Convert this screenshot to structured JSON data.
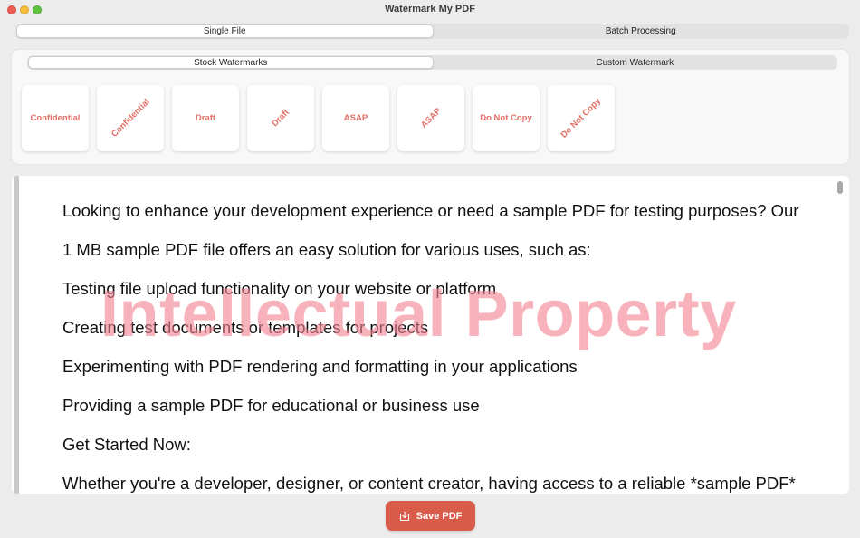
{
  "window": {
    "title": "Watermark My PDF"
  },
  "mode_tabs": [
    "Single File",
    "Batch Processing"
  ],
  "watermark_tabs": [
    "Stock Watermarks",
    "Custom Watermark"
  ],
  "stock_watermarks": [
    {
      "label": "Confidential",
      "orientation": "horizontal"
    },
    {
      "label": "Confidential",
      "orientation": "diagonal"
    },
    {
      "label": "Draft",
      "orientation": "horizontal"
    },
    {
      "label": "Draft",
      "orientation": "diagonal"
    },
    {
      "label": "ASAP",
      "orientation": "horizontal"
    },
    {
      "label": "ASAP",
      "orientation": "diagonal"
    },
    {
      "label": "Do Not Copy",
      "orientation": "horizontal"
    },
    {
      "label": "Do Not Copy",
      "orientation": "diagonal"
    }
  ],
  "document": {
    "lines": [
      "Looking to enhance your development experience or need a sample PDF for testing purposes? Our",
      "1 MB sample PDF file offers an easy solution for various uses, such as:",
      "Testing file upload functionality on your website or platform",
      "Creating test documents or templates for projects",
      "Experimenting with PDF rendering and formatting in your applications",
      "Providing a sample PDF for educational or business use",
      "Get Started Now:",
      "Whether you're a developer, designer, or content creator, having access to a reliable *sample PDF*"
    ],
    "watermark_text": "Intellectual Property"
  },
  "actions": {
    "save_label": "Save PDF"
  },
  "colors": {
    "accent": "#d95b4a",
    "tile_text": "#e06f65",
    "watermark": "#f28292"
  },
  "icons": {
    "save": "save-download-icon"
  }
}
